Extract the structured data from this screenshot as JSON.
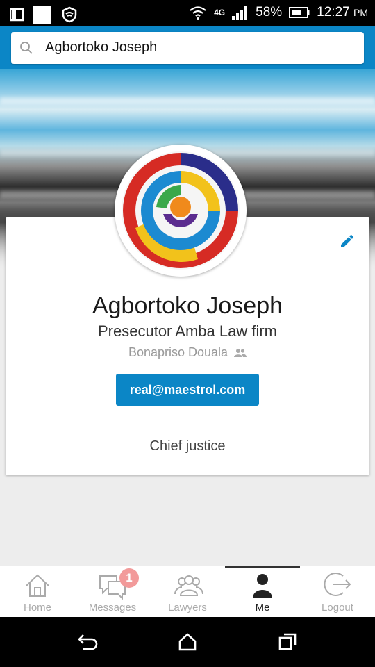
{
  "status_bar": {
    "battery_percent": "58%",
    "time": "12:27",
    "time_suffix": "PM",
    "network": "4G"
  },
  "search": {
    "query": "Agbortoko Joseph"
  },
  "profile": {
    "name": "Agbortoko Joseph",
    "headline": "Presecutor Amba Law firm",
    "location": "Bonapriso Douala",
    "email": "real@maestrol.com",
    "summary": "Chief justice"
  },
  "bottom_nav": {
    "items": [
      {
        "label": "Home",
        "icon": "home-icon"
      },
      {
        "label": "Messages",
        "icon": "messages-icon",
        "badge": "1"
      },
      {
        "label": "Lawyers",
        "icon": "lawyers-icon"
      },
      {
        "label": "Me",
        "icon": "person-icon",
        "active": true
      },
      {
        "label": "Logout",
        "icon": "logout-icon"
      }
    ]
  },
  "colors": {
    "accent": "#0b86c6",
    "badge": "#f29a9a"
  }
}
